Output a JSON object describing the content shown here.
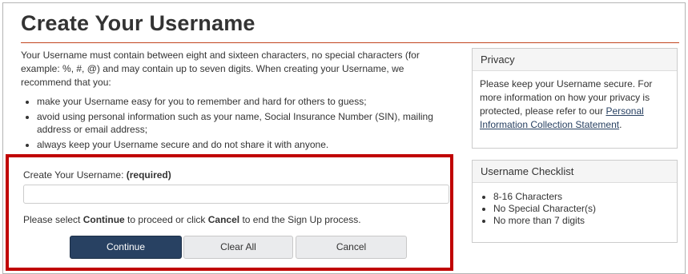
{
  "page": {
    "title": "Create Your Username",
    "intro": "Your Username must contain between eight and sixteen characters, no special characters (for example: %, #, @) and may contain up to seven digits. When creating your Username, we recommend that you:",
    "tips": [
      "make your Username easy for you to remember and hard for others to guess;",
      "avoid using personal information such as your name, Social Insurance Number (SIN), mailing address or email address;",
      "always keep your Username secure and do not share it with anyone."
    ]
  },
  "privacy": {
    "heading": "Privacy",
    "text": "Please keep your Username secure. For more information on how your privacy is protected, please refer to our",
    "link": "Personal Information Collection Statement",
    "end": "."
  },
  "checklist": {
    "heading": "Username Checklist",
    "items": [
      "8-16 Characters",
      "No Special Character(s)",
      "No more than 7 digits"
    ]
  },
  "form": {
    "label": "Create Your Username:",
    "required": "(required)",
    "input_value": "",
    "instr_pre": "Please select ",
    "instr_continue": "Continue",
    "instr_mid": " to proceed or click ",
    "instr_cancel": "Cancel",
    "instr_post": " to end the Sign Up process."
  },
  "buttons": {
    "continue": "Continue",
    "clear_all": "Clear All",
    "cancel": "Cancel"
  },
  "colors": {
    "title_rule": "#c2461f",
    "primary_button": "#284162",
    "highlight_box": "#c00000"
  }
}
